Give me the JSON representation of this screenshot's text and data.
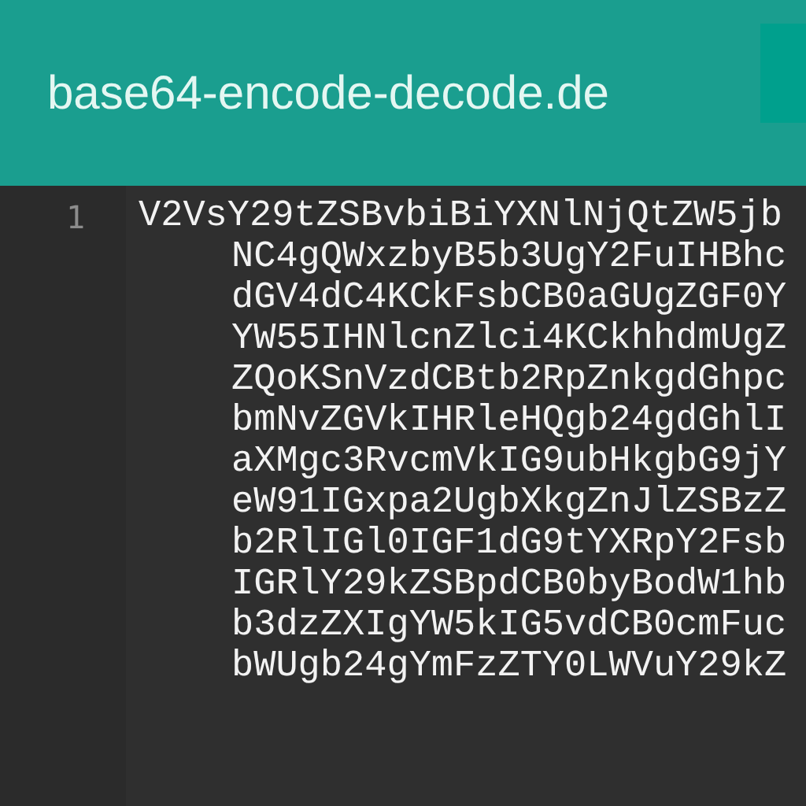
{
  "header": {
    "title": "base64-encode-decode.de"
  },
  "editor": {
    "line_number": "1",
    "lines": [
      "V2VsY29tZSBvbiBiYXNlNjQtZW5jb",
      "NC4gQWxzbyB5b3UgY2FuIHBhc",
      "dGV4dC4KCkFsbCB0aGUgZGF0Y",
      "YW55IHNlcnZlci4KCkhhdmUgZ",
      "ZQoKSnVzdCBtb2RpZnkgdGhpc",
      "bmNvZGVkIHRleHQgb24gdGhlI",
      "aXMgc3RvcmVkIG9ubHkgbG9jY",
      "eW91IGxpa2UgbXkgZnJlZSBzZ",
      "b2RlIGl0IGF1dG9tYXRpY2Fsb",
      "IGRlY29kZSBpdCB0byBodW1hb",
      "b3dzZXIgYW5kIG5vdCB0cmFuc",
      "bWUgb24gYmFzZTY0LWVuY29kZ"
    ]
  }
}
